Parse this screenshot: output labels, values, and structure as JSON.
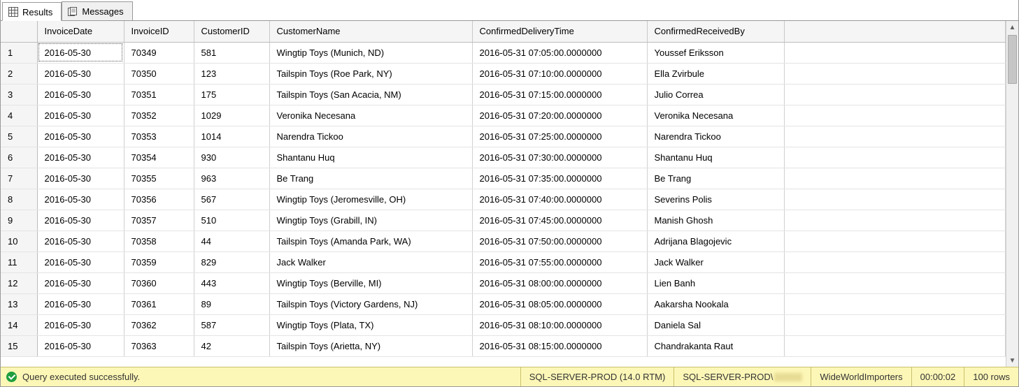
{
  "tabs": {
    "results": "Results",
    "messages": "Messages"
  },
  "columns": {
    "invoiceDate": "InvoiceDate",
    "invoiceId": "InvoiceID",
    "customerId": "CustomerID",
    "customerName": "CustomerName",
    "confirmedDeliveryTime": "ConfirmedDeliveryTime",
    "confirmedReceivedBy": "ConfirmedReceivedBy"
  },
  "rows": [
    {
      "n": "1",
      "invoiceDate": "2016-05-30",
      "invoiceId": "70349",
      "customerId": "581",
      "customerName": "Wingtip Toys (Munich, ND)",
      "confirmedDeliveryTime": "2016-05-31 07:05:00.0000000",
      "confirmedReceivedBy": "Youssef Eriksson"
    },
    {
      "n": "2",
      "invoiceDate": "2016-05-30",
      "invoiceId": "70350",
      "customerId": "123",
      "customerName": "Tailspin Toys (Roe Park, NY)",
      "confirmedDeliveryTime": "2016-05-31 07:10:00.0000000",
      "confirmedReceivedBy": "Ella Zvirbule"
    },
    {
      "n": "3",
      "invoiceDate": "2016-05-30",
      "invoiceId": "70351",
      "customerId": "175",
      "customerName": "Tailspin Toys (San Acacia, NM)",
      "confirmedDeliveryTime": "2016-05-31 07:15:00.0000000",
      "confirmedReceivedBy": "Julio Correa"
    },
    {
      "n": "4",
      "invoiceDate": "2016-05-30",
      "invoiceId": "70352",
      "customerId": "1029",
      "customerName": "Veronika Necesana",
      "confirmedDeliveryTime": "2016-05-31 07:20:00.0000000",
      "confirmedReceivedBy": "Veronika Necesana"
    },
    {
      "n": "5",
      "invoiceDate": "2016-05-30",
      "invoiceId": "70353",
      "customerId": "1014",
      "customerName": "Narendra Tickoo",
      "confirmedDeliveryTime": "2016-05-31 07:25:00.0000000",
      "confirmedReceivedBy": "Narendra Tickoo"
    },
    {
      "n": "6",
      "invoiceDate": "2016-05-30",
      "invoiceId": "70354",
      "customerId": "930",
      "customerName": "Shantanu Huq",
      "confirmedDeliveryTime": "2016-05-31 07:30:00.0000000",
      "confirmedReceivedBy": "Shantanu Huq"
    },
    {
      "n": "7",
      "invoiceDate": "2016-05-30",
      "invoiceId": "70355",
      "customerId": "963",
      "customerName": "Be Trang",
      "confirmedDeliveryTime": "2016-05-31 07:35:00.0000000",
      "confirmedReceivedBy": "Be Trang"
    },
    {
      "n": "8",
      "invoiceDate": "2016-05-30",
      "invoiceId": "70356",
      "customerId": "567",
      "customerName": "Wingtip Toys (Jeromesville, OH)",
      "confirmedDeliveryTime": "2016-05-31 07:40:00.0000000",
      "confirmedReceivedBy": "Severins Polis"
    },
    {
      "n": "9",
      "invoiceDate": "2016-05-30",
      "invoiceId": "70357",
      "customerId": "510",
      "customerName": "Wingtip Toys (Grabill, IN)",
      "confirmedDeliveryTime": "2016-05-31 07:45:00.0000000",
      "confirmedReceivedBy": "Manish Ghosh"
    },
    {
      "n": "10",
      "invoiceDate": "2016-05-30",
      "invoiceId": "70358",
      "customerId": "44",
      "customerName": "Tailspin Toys (Amanda Park, WA)",
      "confirmedDeliveryTime": "2016-05-31 07:50:00.0000000",
      "confirmedReceivedBy": "Adrijana Blagojevic"
    },
    {
      "n": "11",
      "invoiceDate": "2016-05-30",
      "invoiceId": "70359",
      "customerId": "829",
      "customerName": "Jack Walker",
      "confirmedDeliveryTime": "2016-05-31 07:55:00.0000000",
      "confirmedReceivedBy": "Jack Walker"
    },
    {
      "n": "12",
      "invoiceDate": "2016-05-30",
      "invoiceId": "70360",
      "customerId": "443",
      "customerName": "Wingtip Toys (Berville, MI)",
      "confirmedDeliveryTime": "2016-05-31 08:00:00.0000000",
      "confirmedReceivedBy": "Lien Banh"
    },
    {
      "n": "13",
      "invoiceDate": "2016-05-30",
      "invoiceId": "70361",
      "customerId": "89",
      "customerName": "Tailspin Toys (Victory Gardens, NJ)",
      "confirmedDeliveryTime": "2016-05-31 08:05:00.0000000",
      "confirmedReceivedBy": "Aakarsha Nookala"
    },
    {
      "n": "14",
      "invoiceDate": "2016-05-30",
      "invoiceId": "70362",
      "customerId": "587",
      "customerName": "Wingtip Toys (Plata, TX)",
      "confirmedDeliveryTime": "2016-05-31 08:10:00.0000000",
      "confirmedReceivedBy": "Daniela Sal"
    },
    {
      "n": "15",
      "invoiceDate": "2016-05-30",
      "invoiceId": "70363",
      "customerId": "42",
      "customerName": "Tailspin Toys (Arietta, NY)",
      "confirmedDeliveryTime": "2016-05-31 08:15:00.0000000",
      "confirmedReceivedBy": "Chandrakanta Raut"
    }
  ],
  "status": {
    "message": "Query executed successfully.",
    "server": "SQL-SERVER-PROD (14.0 RTM)",
    "login": "SQL-SERVER-PROD\\",
    "database": "WideWorldImporters",
    "elapsed": "00:00:02",
    "rowcount": "100 rows"
  }
}
